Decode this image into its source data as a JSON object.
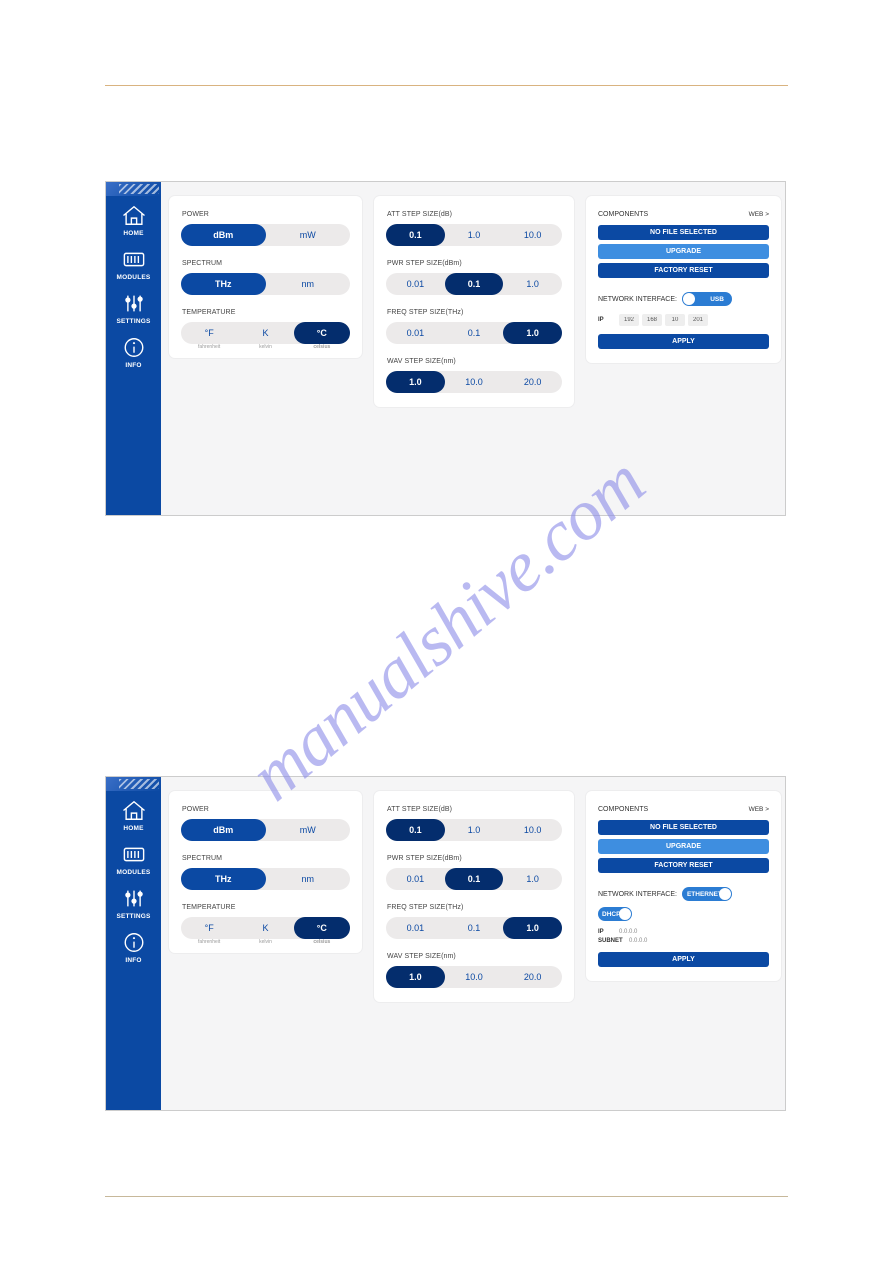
{
  "watermark": "manualshive.com",
  "nav": {
    "home": "HOME",
    "modules": "MODULES",
    "settings": "SETTINGS",
    "info": "INFO"
  },
  "app1": {
    "left": {
      "power_label": "POWER",
      "power": [
        "dBm",
        "mW"
      ],
      "power_sel": 0,
      "power_sub": [
        "",
        ""
      ],
      "spectrum_label": "SPECTRUM",
      "spectrum": [
        "THz",
        "nm"
      ],
      "spectrum_sel": 0,
      "temp_label": "TEMPERATURE",
      "temp": [
        "°F",
        "K",
        "°C"
      ],
      "temp_sel": 2,
      "temp_sub": [
        "fahrenheit",
        "kelvin",
        "celsius"
      ]
    },
    "mid": {
      "att_label": "ATT STEP SIZE(dB)",
      "att": [
        "0.1",
        "1.0",
        "10.0"
      ],
      "att_sel": 0,
      "pwr_label": "PWR STEP SIZE(dBm)",
      "pwr": [
        "0.01",
        "0.1",
        "1.0"
      ],
      "pwr_sel": 1,
      "freq_label": "FREQ STEP SIZE(THz)",
      "freq": [
        "0.01",
        "0.1",
        "1.0"
      ],
      "freq_sel": 2,
      "wav_label": "WAV STEP SIZE(nm)",
      "wav": [
        "1.0",
        "10.0",
        "20.0"
      ],
      "wav_sel": 0
    },
    "right": {
      "components_label": "COMPONENTS",
      "web": "WEB >",
      "nofile": "NO FILE SELECTED",
      "upgrade": "UPGRADE",
      "reset": "FACTORY RESET",
      "net_label": "NETWORK INTERFACE:",
      "net_mode": "USB",
      "ip_label": "IP",
      "ip": [
        "192",
        "168",
        "10",
        "201"
      ],
      "apply": "APPLY"
    }
  },
  "app2": {
    "left": {
      "power_label": "POWER",
      "power": [
        "dBm",
        "mW"
      ],
      "power_sel": 0,
      "spectrum_label": "SPECTRUM",
      "spectrum": [
        "THz",
        "nm"
      ],
      "spectrum_sel": 0,
      "temp_label": "TEMPERATURE",
      "temp": [
        "°F",
        "K",
        "°C"
      ],
      "temp_sel": 2,
      "temp_sub": [
        "fahrenheit",
        "kelvin",
        "celsius"
      ]
    },
    "mid": {
      "att_label": "ATT STEP SIZE(dB)",
      "att": [
        "0.1",
        "1.0",
        "10.0"
      ],
      "att_sel": 0,
      "pwr_label": "PWR STEP SIZE(dBm)",
      "pwr": [
        "0.01",
        "0.1",
        "1.0"
      ],
      "pwr_sel": 1,
      "freq_label": "FREQ STEP SIZE(THz)",
      "freq": [
        "0.01",
        "0.1",
        "1.0"
      ],
      "freq_sel": 2,
      "wav_label": "WAV STEP SIZE(nm)",
      "wav": [
        "1.0",
        "10.0",
        "20.0"
      ],
      "wav_sel": 0
    },
    "right": {
      "components_label": "COMPONENTS",
      "web": "WEB >",
      "nofile": "NO FILE SELECTED",
      "upgrade": "UPGRADE",
      "reset": "FACTORY RESET",
      "net_label": "NETWORK INTERFACE:",
      "net_mode": "ETHERNET",
      "dhcp_label": "DHCP",
      "ip_label": "IP",
      "ip_val": "0.0.0.0",
      "subnet_label": "SUBNET",
      "subnet_val": "0.0.0.0",
      "apply": "APPLY"
    }
  }
}
